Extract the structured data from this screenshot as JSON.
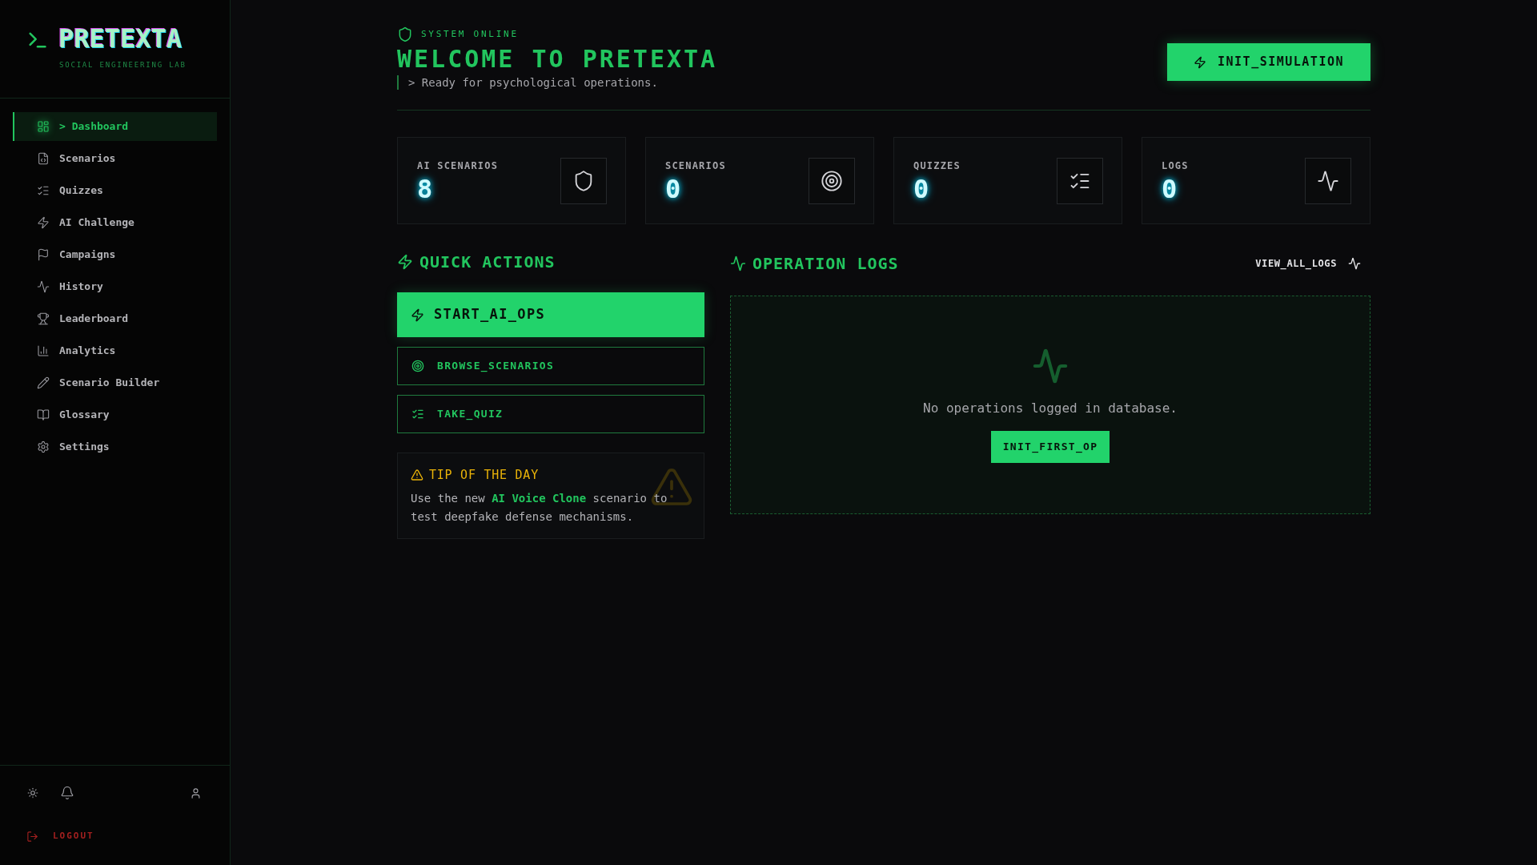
{
  "sidebar": {
    "logo": {
      "title": "PRETEXTA",
      "subtitle": "SOCIAL ENGINEERING LAB"
    },
    "nav_items": [
      {
        "label": "> Dashboard",
        "selected": true
      },
      {
        "label": "Scenarios",
        "selected": false
      },
      {
        "label": "Quizzes",
        "selected": false
      },
      {
        "label": "AI Challenge",
        "selected": false
      },
      {
        "label": "Campaigns",
        "selected": false
      },
      {
        "label": "History",
        "selected": false
      },
      {
        "label": "Leaderboard",
        "selected": false
      },
      {
        "label": "Analytics",
        "selected": false
      },
      {
        "label": "Scenario Builder",
        "selected": false
      },
      {
        "label": "Glossary",
        "selected": false
      },
      {
        "label": "Settings",
        "selected": false
      }
    ],
    "logout": {
      "label": "LOGOUT"
    }
  },
  "header": {
    "status": "SYSTEM ONLINE",
    "title": "WELCOME TO PRETEXTA",
    "subtitle": "> Ready for psychological operations.",
    "action_button": "INIT_SIMULATION"
  },
  "stats": [
    {
      "label": "AI SCENARIOS",
      "value": "8"
    },
    {
      "label": "SCENARIOS",
      "value": "0"
    },
    {
      "label": "QUIZZES",
      "value": "0"
    },
    {
      "label": "LOGS",
      "value": "0"
    }
  ],
  "quick_actions": {
    "title": "QUICK ACTIONS",
    "buttons": [
      {
        "label": "START_AI_OPS",
        "kind": "primary"
      },
      {
        "label": "BROWSE_SCENARIOS",
        "kind": "outline"
      },
      {
        "label": "TAKE_QUIZ",
        "kind": "outline"
      }
    ]
  },
  "tip": {
    "title": "TIP OF THE DAY",
    "text": "Use the new **AI Voice Clone** scenario to test deepfake defense mechanisms."
  },
  "operation_logs": {
    "title": "OPERATION LOGS",
    "link": "VIEW_ALL_LOGS",
    "empty_message": "No operations logged in database.",
    "empty_button": "INIT_FIRST_OP"
  }
}
